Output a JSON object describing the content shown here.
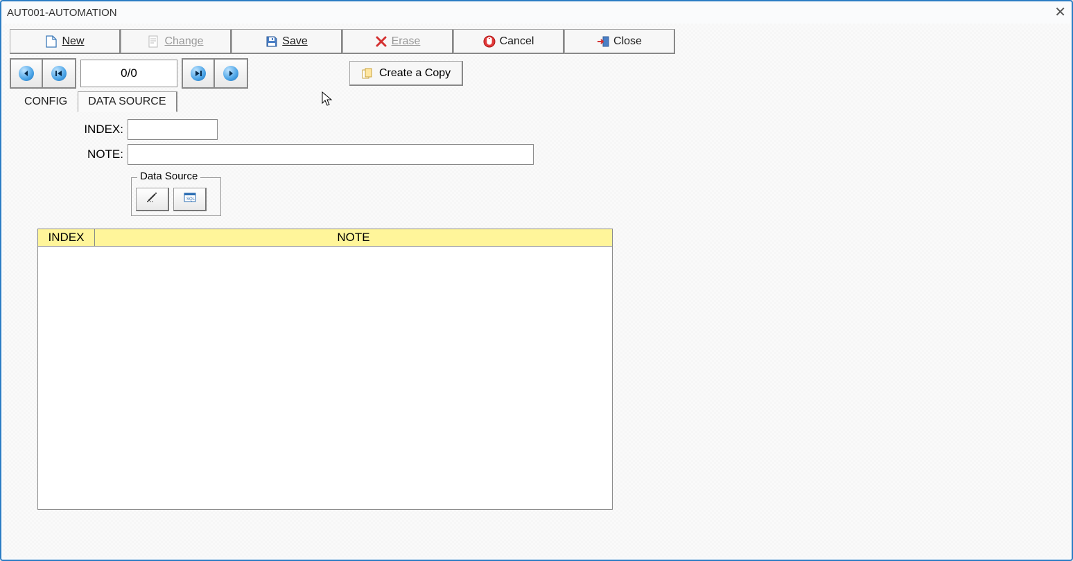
{
  "window": {
    "title": "AUT001-AUTOMATION"
  },
  "toolbar": {
    "new": "New",
    "change": "Change",
    "save": "Save",
    "erase": "Erase",
    "cancel": "Cancel",
    "close": "Close"
  },
  "nav": {
    "pager": "0/0",
    "copy": "Create a Copy"
  },
  "tabs": {
    "config": "CONFIG",
    "datasource": "DATA SOURCE"
  },
  "form": {
    "index_label": "INDEX:",
    "index_value": "",
    "note_label": "NOTE:",
    "note_value": ""
  },
  "groupbox": {
    "legend": "Data Source"
  },
  "grid": {
    "columns": [
      "INDEX",
      "NOTE"
    ],
    "rows": []
  }
}
